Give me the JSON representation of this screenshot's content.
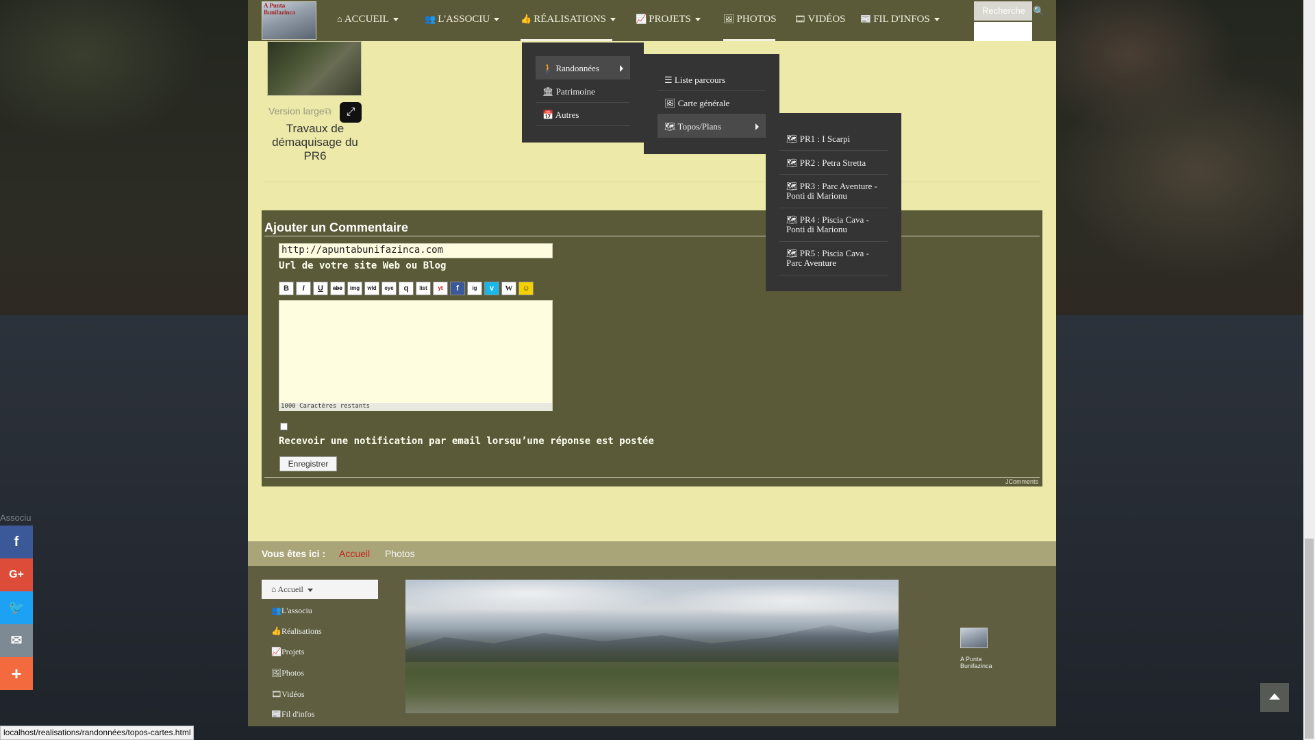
{
  "logo": {
    "text": "A Punta Bunifazinca"
  },
  "nav": {
    "items": [
      {
        "icon": "⌂",
        "label": "ACCUEIL"
      },
      {
        "icon": "👥",
        "label": "L'ASSOCIU"
      },
      {
        "icon": "👍",
        "label": "RÉALISATIONS"
      },
      {
        "icon": "📈",
        "label": "PROJETS"
      },
      {
        "icon": "🖼",
        "label": "PHOTOS"
      },
      {
        "icon": "🎞",
        "label": "VIDÉOS"
      },
      {
        "icon": "📰",
        "label": "FIL D'INFOS"
      }
    ],
    "search_placeholder": "Recherche"
  },
  "menu_realisations": [
    {
      "icon": "🚶",
      "label": "Randonnées"
    },
    {
      "icon": "🏛",
      "label": "Patrimoine"
    },
    {
      "icon": "📅",
      "label": "Autres"
    }
  ],
  "menu_randonnees": [
    {
      "icon": "☰",
      "label": "Liste parcours"
    },
    {
      "icon": "🖼",
      "label": "Carte générale"
    },
    {
      "icon": "🗺",
      "label": "Topos/Plans"
    }
  ],
  "menu_topos": [
    {
      "icon": "🗺",
      "label": "PR1 : I Scarpi"
    },
    {
      "icon": "🗺",
      "label": "PR2 : Petra Stretta"
    },
    {
      "icon": "🗺",
      "label": "PR3 : Parc Aventure - Ponti di Marionu"
    },
    {
      "icon": "🗺",
      "label": "PR4 : Piscia Cava - Ponti di Marionu"
    },
    {
      "icon": "🗺",
      "label": "PR5 : Piscia Cava - Parc Aventure"
    }
  ],
  "gallery": {
    "version_large": "Version large",
    "title": "Travaux de démaquisage du PR6"
  },
  "comment": {
    "title": "Ajouter un Commentaire",
    "url_value": "http://apuntabunifazinca.com",
    "url_label": "Url de votre site Web ou Blog",
    "chars_left": "1000 Caractères restants",
    "notify_label": "Recevoir une notification par email lorsqu’une réponse est postée",
    "save_label": "Enregistrer",
    "credit": "JComments",
    "toolbar": [
      "B",
      "I",
      "U",
      "abc",
      "img",
      "wld",
      "eye",
      "q",
      "list",
      "yt",
      "f",
      "ig",
      "v",
      "W",
      "☺"
    ]
  },
  "breadcrumb": {
    "label": "Vous êtes ici :",
    "home": "Accueil",
    "current": "Photos"
  },
  "footer": {
    "nav_top": "Accueil",
    "nav_items": [
      {
        "icon": "👥",
        "label": "L'associu"
      },
      {
        "icon": "👍",
        "label": "Réalisations"
      },
      {
        "icon": "📈",
        "label": "Projets"
      },
      {
        "icon": "🖼",
        "label": "Photos"
      },
      {
        "icon": "🎞",
        "label": "Vidéos"
      },
      {
        "icon": "📰",
        "label": "Fil d'infos"
      }
    ],
    "logo_caption": "A Punta Bunifazinca"
  },
  "social": {
    "label": "Associu",
    "buttons": [
      {
        "glyph": "f",
        "color": "#3b5998"
      },
      {
        "glyph": "G+",
        "color": "#dd4b39"
      },
      {
        "glyph": "🐦",
        "color": "#1da1f2"
      },
      {
        "glyph": "✉",
        "color": "#7d8a94"
      },
      {
        "glyph": "+",
        "color": "#f26a3d"
      }
    ]
  },
  "status_url": "localhost/realisations/randonnées/topos-cartes.html"
}
